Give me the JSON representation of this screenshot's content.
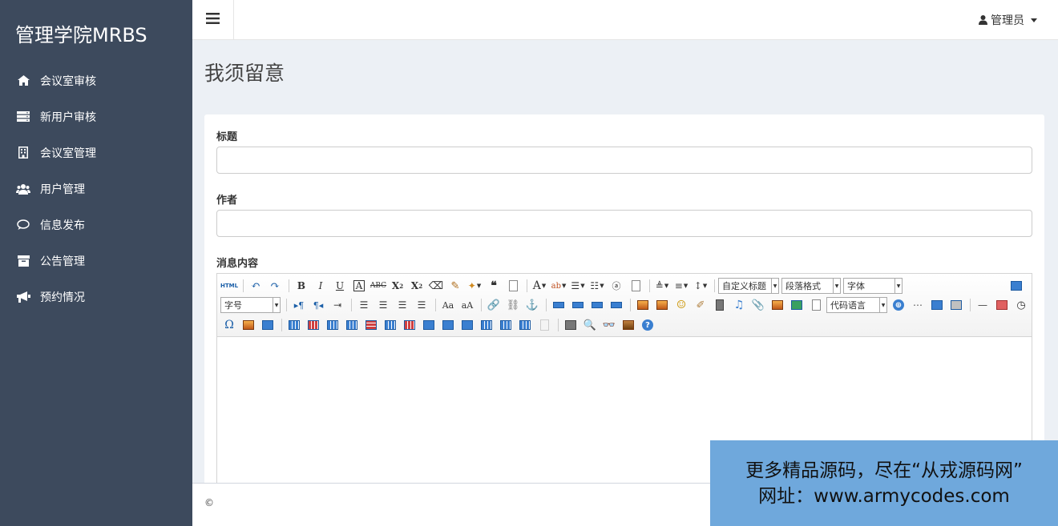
{
  "sidebar": {
    "brand": "管理学院MRBS",
    "items": [
      {
        "label": "会议室审核",
        "icon": "home-icon"
      },
      {
        "label": "新用户审核",
        "icon": "server-icon"
      },
      {
        "label": "会议室管理",
        "icon": "building-icon"
      },
      {
        "label": "用户管理",
        "icon": "users-icon"
      },
      {
        "label": "信息发布",
        "icon": "comment-icon"
      },
      {
        "label": "公告管理",
        "icon": "archive-icon"
      },
      {
        "label": "预约情况",
        "icon": "bullhorn-icon"
      }
    ]
  },
  "topbar": {
    "user_label": "管理员"
  },
  "page": {
    "title": "我须留意"
  },
  "form": {
    "title_label": "标题",
    "title_value": "",
    "author_label": "作者",
    "author_value": "",
    "content_label": "消息内容"
  },
  "editor": {
    "custom_title_combo": "自定义标题",
    "paragraph_combo": "段落格式",
    "font_combo": "字体",
    "font_size_combo": "字号",
    "code_lang_combo": "代码语言",
    "html_button": "HTML"
  },
  "footer": {
    "text": "© "
  },
  "watermark": {
    "line1": "更多精品源码，尽在“从戎源码网”",
    "line2": "网址：www.armycodes.com"
  },
  "colors": {
    "sidebar_bg": "#3d4a5d",
    "content_bg": "#ecf0f5",
    "watermark_bg": "#6fa8dc"
  }
}
